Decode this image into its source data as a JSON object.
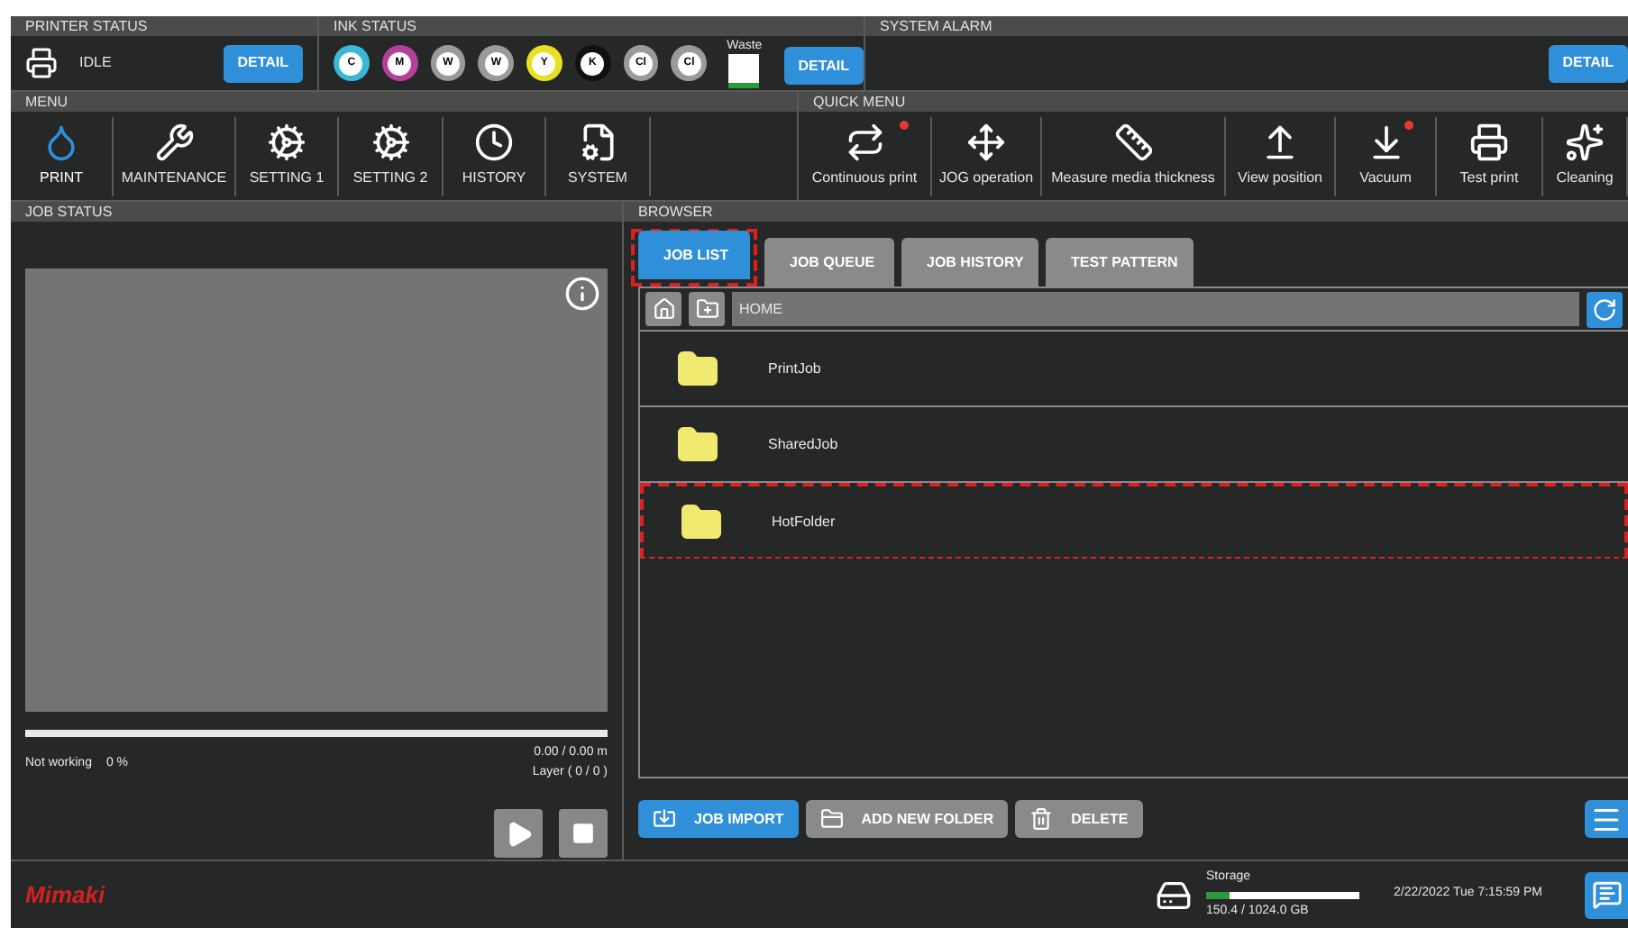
{
  "printer_status": {
    "title": "PRINTER STATUS",
    "state": "IDLE",
    "button": "DETAIL"
  },
  "ink_status": {
    "title": "INK STATUS",
    "inks": [
      {
        "label": "C",
        "color": "#3bb8d6"
      },
      {
        "label": "M",
        "color": "#b5409a"
      },
      {
        "label": "W",
        "color": "#9a9a9a"
      },
      {
        "label": "W",
        "color": "#9a9a9a"
      },
      {
        "label": "Y",
        "color": "#e8e020"
      },
      {
        "label": "K",
        "color": "#111111"
      },
      {
        "label": "Cl",
        "color": "#9a9a9a"
      },
      {
        "label": "Cl",
        "color": "#9a9a9a"
      }
    ],
    "waste": {
      "label": "Waste",
      "level": 0.15
    },
    "button": "DETAIL"
  },
  "system_alarm": {
    "title": "SYSTEM ALARM",
    "button": "DETAIL"
  },
  "menu": {
    "title": "MENU",
    "items": [
      {
        "label": "PRINT",
        "selected": true
      },
      {
        "label": "MAINTENANCE",
        "selected": false
      },
      {
        "label": "SETTING 1",
        "selected": false
      },
      {
        "label": "SETTING 2",
        "selected": false
      },
      {
        "label": "HISTORY",
        "selected": false
      },
      {
        "label": "SYSTEM",
        "selected": false
      }
    ]
  },
  "quick_menu": {
    "title": "QUICK MENU",
    "items": [
      {
        "label": "Continuous print",
        "alert": true
      },
      {
        "label": "JOG operation",
        "alert": false
      },
      {
        "label": "Measure media thickness",
        "alert": false
      },
      {
        "label": "View position",
        "alert": false
      },
      {
        "label": "Vacuum",
        "alert": true
      },
      {
        "label": "Test print",
        "alert": false
      },
      {
        "label": "Cleaning",
        "alert": false
      }
    ]
  },
  "job_status": {
    "title": "JOB STATUS",
    "level": 0,
    "state": "Not working",
    "percent": "0 %",
    "length": "0.00 / 0.00 m",
    "layer": "Layer ( 0 / 0 )"
  },
  "browser": {
    "title": "BROWSER",
    "tabs": [
      {
        "label": "JOB LIST",
        "selected": true,
        "highlighted": true
      },
      {
        "label": "JOB QUEUE",
        "selected": false,
        "highlighted": false
      },
      {
        "label": "JOB HISTORY",
        "selected": false,
        "highlighted": false
      },
      {
        "label": "TEST PATTERN",
        "selected": false,
        "highlighted": false
      }
    ],
    "path": "HOME",
    "rows": [
      {
        "name": "PrintJob",
        "highlighted": false
      },
      {
        "name": "SharedJob",
        "highlighted": false
      },
      {
        "name": "HotFolder",
        "highlighted": true
      }
    ],
    "buttons": [
      {
        "label": "JOB IMPORT",
        "kind": "primary"
      },
      {
        "label": "ADD NEW FOLDER",
        "kind": "secondary"
      },
      {
        "label": "DELETE",
        "kind": "secondary"
      }
    ]
  },
  "footer": {
    "logo": "Mimaki",
    "storage": {
      "label": "Storage",
      "level": 0.15,
      "reading": "150.4 / 1024.0 GB"
    },
    "datetime": "2/22/2022 Tue 7:15:59 PM"
  }
}
